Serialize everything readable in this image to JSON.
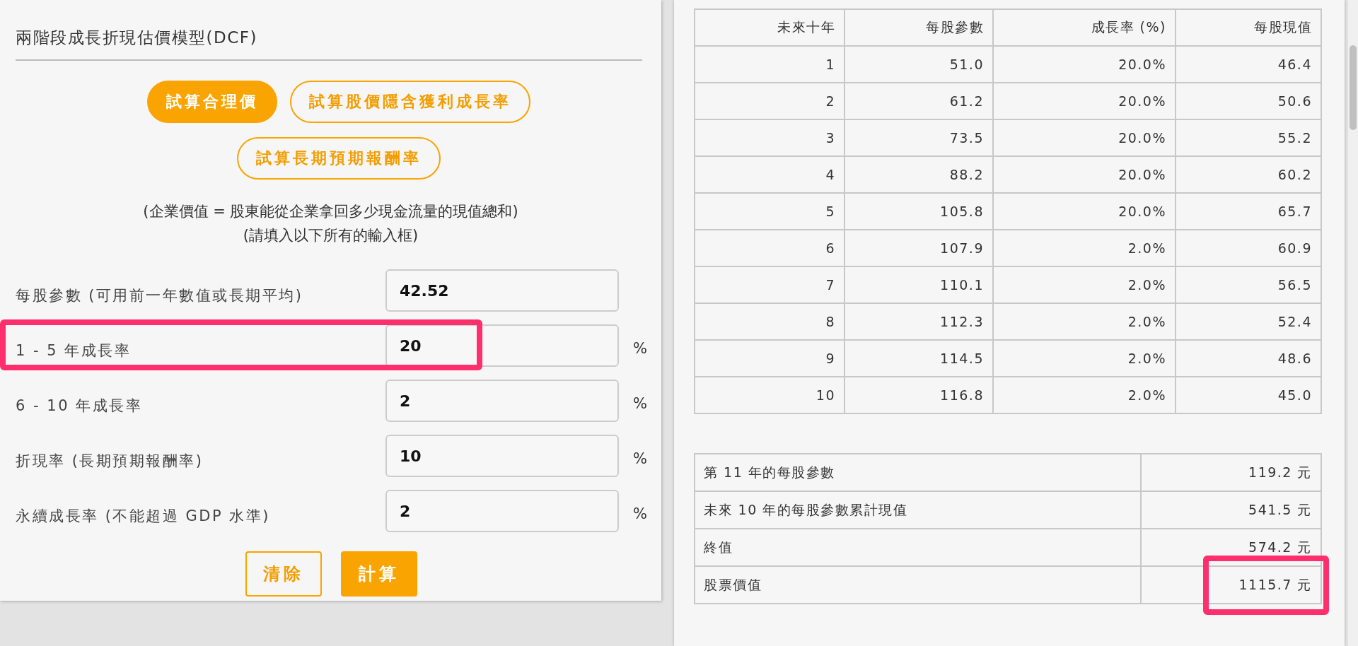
{
  "left_panel": {
    "title": "兩階段成長折現估價模型(DCF)",
    "modes": [
      {
        "label": "試算合理價",
        "selected": true
      },
      {
        "label": "試算股價隱含獲利成長率",
        "selected": false
      },
      {
        "label": "試算長期預期報酬率",
        "selected": false
      }
    ],
    "notes": [
      "(企業價值 = 股東能從企業拿回多少現金流量的現值總和)",
      "(請填入以下所有的輸入框)"
    ],
    "fields": [
      {
        "label": "每股參數 (可用前一年數值或長期平均)",
        "value": "42.52",
        "highlighted": false
      },
      {
        "label": "1 - 5 年成長率",
        "value": "20",
        "unit": "%",
        "highlighted": true
      },
      {
        "label": "6 - 10 年成長率",
        "value": "2",
        "unit": "%",
        "highlighted": false
      },
      {
        "label": "折現率 (長期預期報酬率)",
        "value": "10",
        "unit": "%",
        "highlighted": false
      },
      {
        "label": "永續成長率 (不能超過 GDP 水準)",
        "value": "2",
        "unit": "%",
        "highlighted": false
      }
    ],
    "buttons": [
      {
        "label": "清除",
        "kind": "outline"
      },
      {
        "label": "計算",
        "kind": "filled"
      }
    ]
  },
  "projection_table": {
    "columns": [
      "未來十年",
      "每股參數",
      "成長率 (%)",
      "每股現值"
    ],
    "rows": [
      [
        "1",
        "51.0",
        "20.0%",
        "46.4"
      ],
      [
        "2",
        "61.2",
        "20.0%",
        "50.6"
      ],
      [
        "3",
        "73.5",
        "20.0%",
        "55.2"
      ],
      [
        "4",
        "88.2",
        "20.0%",
        "60.2"
      ],
      [
        "5",
        "105.8",
        "20.0%",
        "65.7"
      ],
      [
        "6",
        "107.9",
        "2.0%",
        "60.9"
      ],
      [
        "7",
        "110.1",
        "2.0%",
        "56.5"
      ],
      [
        "8",
        "112.3",
        "2.0%",
        "52.4"
      ],
      [
        "9",
        "114.5",
        "2.0%",
        "48.6"
      ],
      [
        "10",
        "116.8",
        "2.0%",
        "45.0"
      ]
    ]
  },
  "summary_table": {
    "rows": [
      {
        "label": "第 11 年的每股參數",
        "value": "119.2 元",
        "highlighted": false
      },
      {
        "label": "未來 10 年的每股參數累計現值",
        "value": "541.5 元",
        "highlighted": false
      },
      {
        "label": "終值",
        "value": "574.2 元",
        "highlighted": false
      },
      {
        "label": "股票價值",
        "value": "1115.7 元",
        "highlighted": true
      }
    ]
  }
}
